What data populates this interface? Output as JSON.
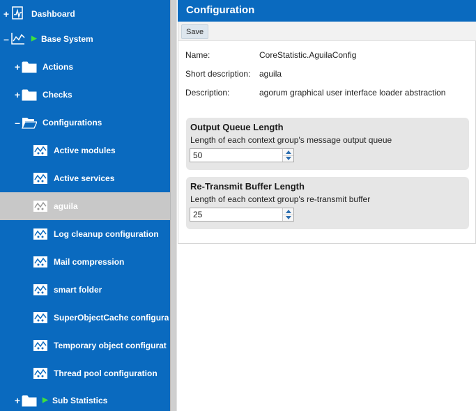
{
  "sidebar": {
    "items": [
      {
        "label": "Dashboard",
        "toggle": "+",
        "icon": "dashboard-icon"
      },
      {
        "label": "Base System",
        "toggle": "–",
        "icon": "statistics-icon"
      },
      {
        "label": "Actions",
        "toggle": "+",
        "icon": "folder-icon"
      },
      {
        "label": "Checks",
        "toggle": "+",
        "icon": "folder-icon"
      },
      {
        "label": "Configurations",
        "toggle": "–",
        "icon": "folder-open-icon"
      },
      {
        "label": "Active modules",
        "icon": "config-icon"
      },
      {
        "label": "Active services",
        "icon": "config-icon"
      },
      {
        "label": "aguila",
        "icon": "config-icon",
        "selected": true
      },
      {
        "label": "Log cleanup configuration",
        "icon": "config-icon"
      },
      {
        "label": "Mail compression",
        "icon": "config-icon"
      },
      {
        "label": "smart folder",
        "icon": "config-icon"
      },
      {
        "label": "SuperObjectCache configura",
        "icon": "config-icon"
      },
      {
        "label": "Temporary object configurat",
        "icon": "config-icon"
      },
      {
        "label": "Thread pool configuration",
        "icon": "config-icon"
      },
      {
        "label": "Sub Statistics",
        "toggle": "+",
        "icon": "folder-icon"
      }
    ]
  },
  "panel": {
    "title": "Configuration",
    "save_label": "Save",
    "info": [
      {
        "label": "Name:",
        "value": "CoreStatistic.AguilaConfig"
      },
      {
        "label": "Short description:",
        "value": "aguila"
      },
      {
        "label": "Description:",
        "value": "agorum graphical user interface loader abstraction"
      }
    ],
    "groups": [
      {
        "title": "Output Queue Length",
        "description": "Length of each context group's message output queue",
        "value": "50"
      },
      {
        "title": "Re-Transmit Buffer Length",
        "description": "Length of each context group's re-transmit buffer",
        "value": "25"
      }
    ]
  },
  "colors": {
    "sidebar_bg": "#0a6abf",
    "selected_bg": "#c8c8c8",
    "play_arrow": "#3ee03e"
  }
}
